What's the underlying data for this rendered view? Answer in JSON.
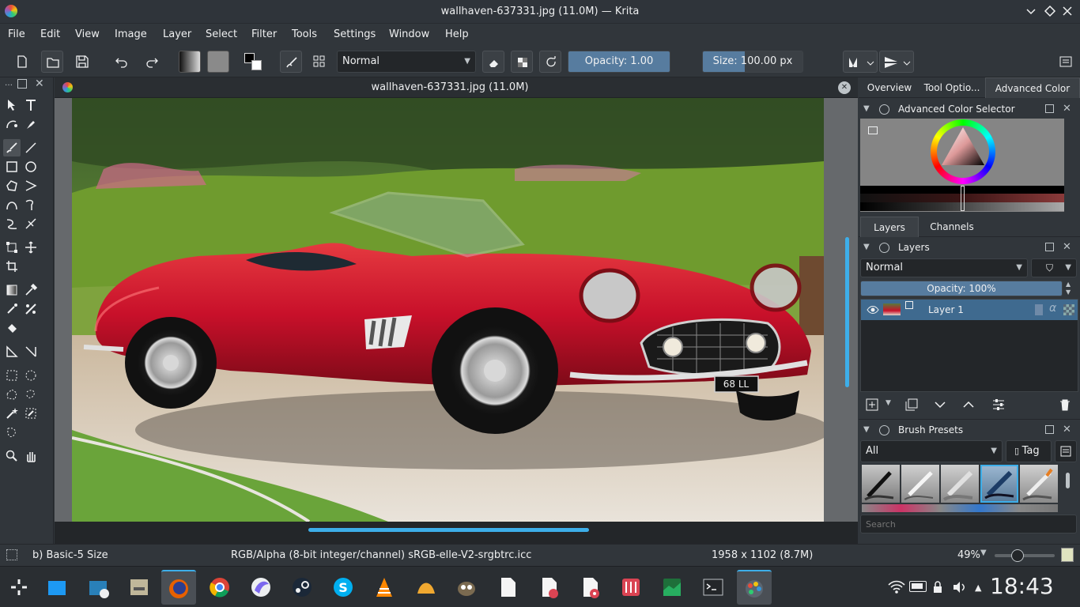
{
  "window": {
    "title": "wallhaven-637331.jpg (11.0M) — Krita"
  },
  "menu": [
    "File",
    "Edit",
    "View",
    "Image",
    "Layer",
    "Select",
    "Filter",
    "Tools",
    "Settings",
    "Window",
    "Help"
  ],
  "toolbar": {
    "blend_mode": "Normal",
    "opacity_label": "Opacity:  1.00",
    "opacity_value": 1.0,
    "size_label": "Size:  100.00 px",
    "size_value": 100.0
  },
  "document": {
    "tab_title": "wallhaven-637331.jpg (11.0M)",
    "plate_text": "68 LL"
  },
  "docker": {
    "tabs": [
      "Overview",
      "Tool Optio...",
      "Advanced Color Se..."
    ],
    "active_tab": "Advanced Color Se...",
    "color_selector_title": "Advanced Color Selector",
    "layers_tabs": [
      "Layers",
      "Channels"
    ],
    "layers_title": "Layers",
    "layer_blend": "Normal",
    "layer_opacity_label": "Opacity:  100%",
    "layer_opacity_value": 100,
    "layers": [
      {
        "name": "Layer 1"
      }
    ],
    "brush_title": "Brush Presets",
    "brush_filter": "All",
    "tag_label": "Tag",
    "search_placeholder": "Search"
  },
  "status": {
    "brush": "b) Basic-5 Size",
    "color_model": "RGB/Alpha (8-bit integer/channel)  sRGB-elle-V2-srgbtrc.icc",
    "dimensions": "1958 x 1102 (8.7M)",
    "zoom": "49%",
    "zoom_value": 49
  },
  "taskbar": {
    "clock": "18:43"
  },
  "colors": {
    "accent": "#3daee9",
    "selection": "#3f6a8f",
    "bg": "#31363b"
  }
}
